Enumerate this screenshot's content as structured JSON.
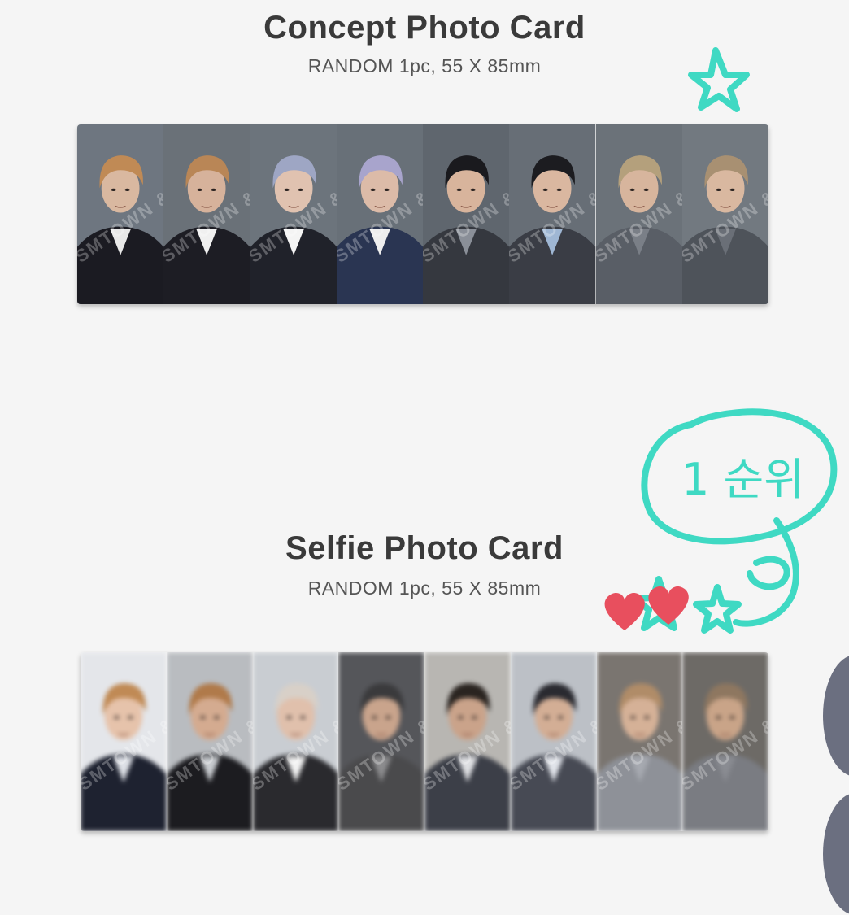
{
  "concept": {
    "title": "Concept Photo Card",
    "subtitle": "RANDOM 1pc, 55 X 85mm",
    "cards": [
      {
        "bg": "#6e7680",
        "skin": "#d9b8a0",
        "hair": "#c08a55",
        "shirt": "#1b1b22",
        "accent": "#e8e8e8"
      },
      {
        "bg": "#6a7178",
        "skin": "#d6b29b",
        "hair": "#b98656",
        "shirt": "#1d1d24",
        "accent": "#f0f0f0"
      },
      {
        "bg": "#6c747c",
        "skin": "#e0c2b0",
        "hair": "#9ea6c4",
        "shirt": "#20222a",
        "accent": "#f4f4f4"
      },
      {
        "bg": "#687078",
        "skin": "#dcbba8",
        "hair": "#a8a4cc",
        "shirt": "#2a3552",
        "accent": "#eeeeee"
      },
      {
        "bg": "#5f666e",
        "skin": "#d8b49c",
        "hair": "#1a1a1e",
        "shirt": "#35383f",
        "accent": "#8a8f98"
      },
      {
        "bg": "#676e76",
        "skin": "#dab7a0",
        "hair": "#1c1c20",
        "shirt": "#3a3d45",
        "accent": "#9fb7d4"
      },
      {
        "bg": "#6b7279",
        "skin": "#d7b59d",
        "hair": "#b4a07c",
        "shirt": "#595e66",
        "accent": "#7a7f87"
      },
      {
        "bg": "#727980",
        "skin": "#d9b8a0",
        "hair": "#a89072",
        "shirt": "#4e535a",
        "accent": "#6a6f77"
      }
    ],
    "watermark": "SMTOWN &STORE"
  },
  "selfie": {
    "title": "Selfie Photo Card",
    "subtitle": "RANDOM 1pc, 55 X 85mm",
    "cards": [
      {
        "bg": "#e4e6ea",
        "skin": "#e6c3ab",
        "hair": "#c08a55",
        "shirt": "#1e2230",
        "accent": "#dfe2e8"
      },
      {
        "bg": "#b9bcc0",
        "skin": "#d4ab90",
        "hair": "#b07a4a",
        "shirt": "#1c1c20",
        "accent": "#c8cbcf"
      },
      {
        "bg": "#c9cdd2",
        "skin": "#e0c0ac",
        "hair": "#d8d0c8",
        "shirt": "#2a2a2e",
        "accent": "#f2f2f2"
      },
      {
        "bg": "#55565a",
        "skin": "#c9a48c",
        "hair": "#3a3a3c",
        "shirt": "#4a4a4c",
        "accent": "#8c8c8e"
      },
      {
        "bg": "#b8b6b2",
        "skin": "#caa38a",
        "hair": "#2a2420",
        "shirt": "#3c3f48",
        "accent": "#dfe0e3"
      },
      {
        "bg": "#bcc0c6",
        "skin": "#d3ae95",
        "hair": "#2a2a30",
        "shirt": "#474a54",
        "accent": "#e1e4ea"
      },
      {
        "bg": "#7a7570",
        "skin": "#d5b197",
        "hair": "#b08c68",
        "shirt": "#8e9198",
        "accent": "#a6a9b0"
      },
      {
        "bg": "#6d6a66",
        "skin": "#c9a488",
        "hair": "#8e7760",
        "shirt": "#7a7c82",
        "accent": "#8a8c92"
      }
    ],
    "watermark": "SMTOWN &STORE"
  },
  "annotation": {
    "note": "1 순위",
    "note_color": "#3fd9c3",
    "heart_color": "#e84f5e"
  }
}
